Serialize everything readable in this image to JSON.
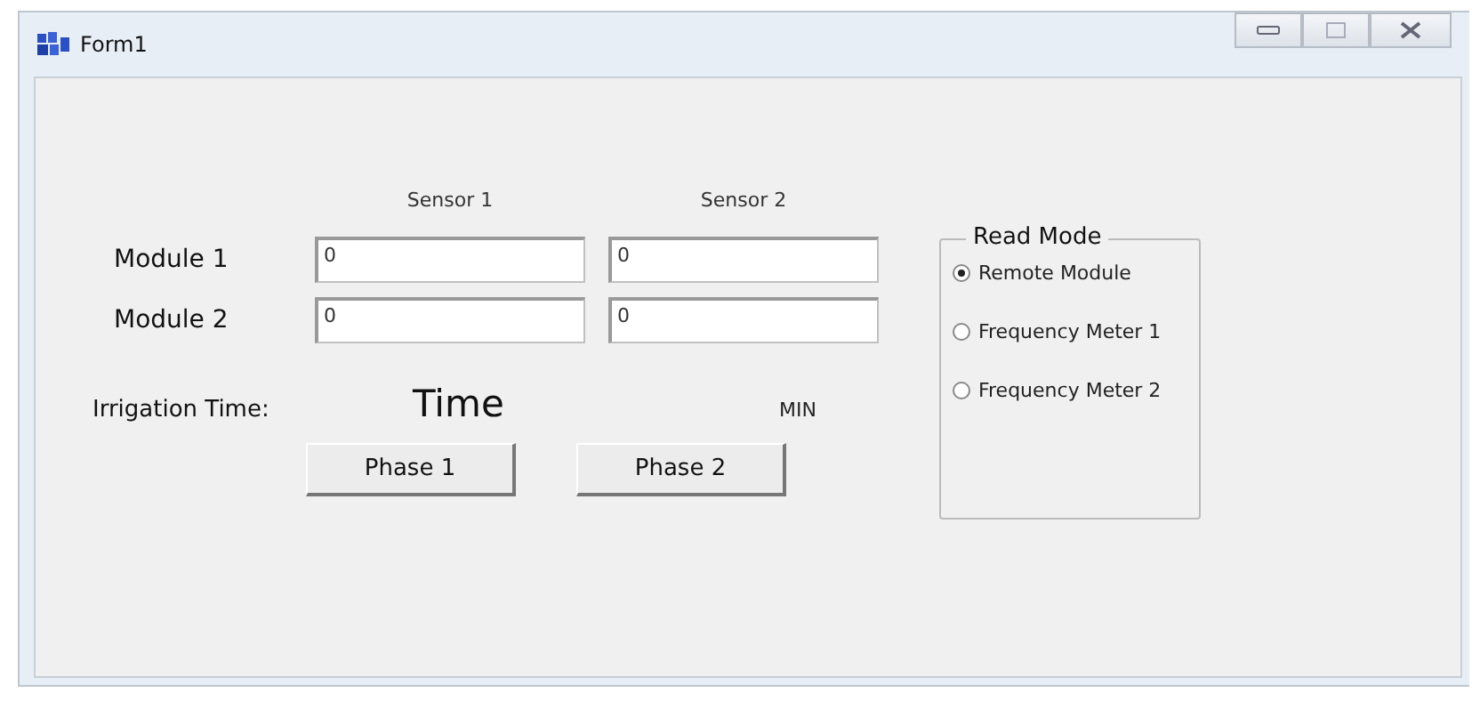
{
  "window": {
    "title": "Form1"
  },
  "columns": [
    "Sensor 1",
    "Sensor 2"
  ],
  "rows": [
    {
      "label": "Module 1",
      "values": [
        "0",
        "0"
      ]
    },
    {
      "label": "Module 2",
      "values": [
        "0",
        "0"
      ]
    }
  ],
  "irrigation": {
    "label": "Irrigation Time:",
    "value": "Time",
    "unit": "MIN"
  },
  "buttons": [
    "Phase 1",
    "Phase 2"
  ],
  "read_mode": {
    "title": "Read Mode",
    "options": [
      {
        "label": "Remote Module",
        "selected": true
      },
      {
        "label": "Frequency Meter 1",
        "selected": false
      },
      {
        "label": "Frequency Meter 2",
        "selected": false
      }
    ]
  }
}
